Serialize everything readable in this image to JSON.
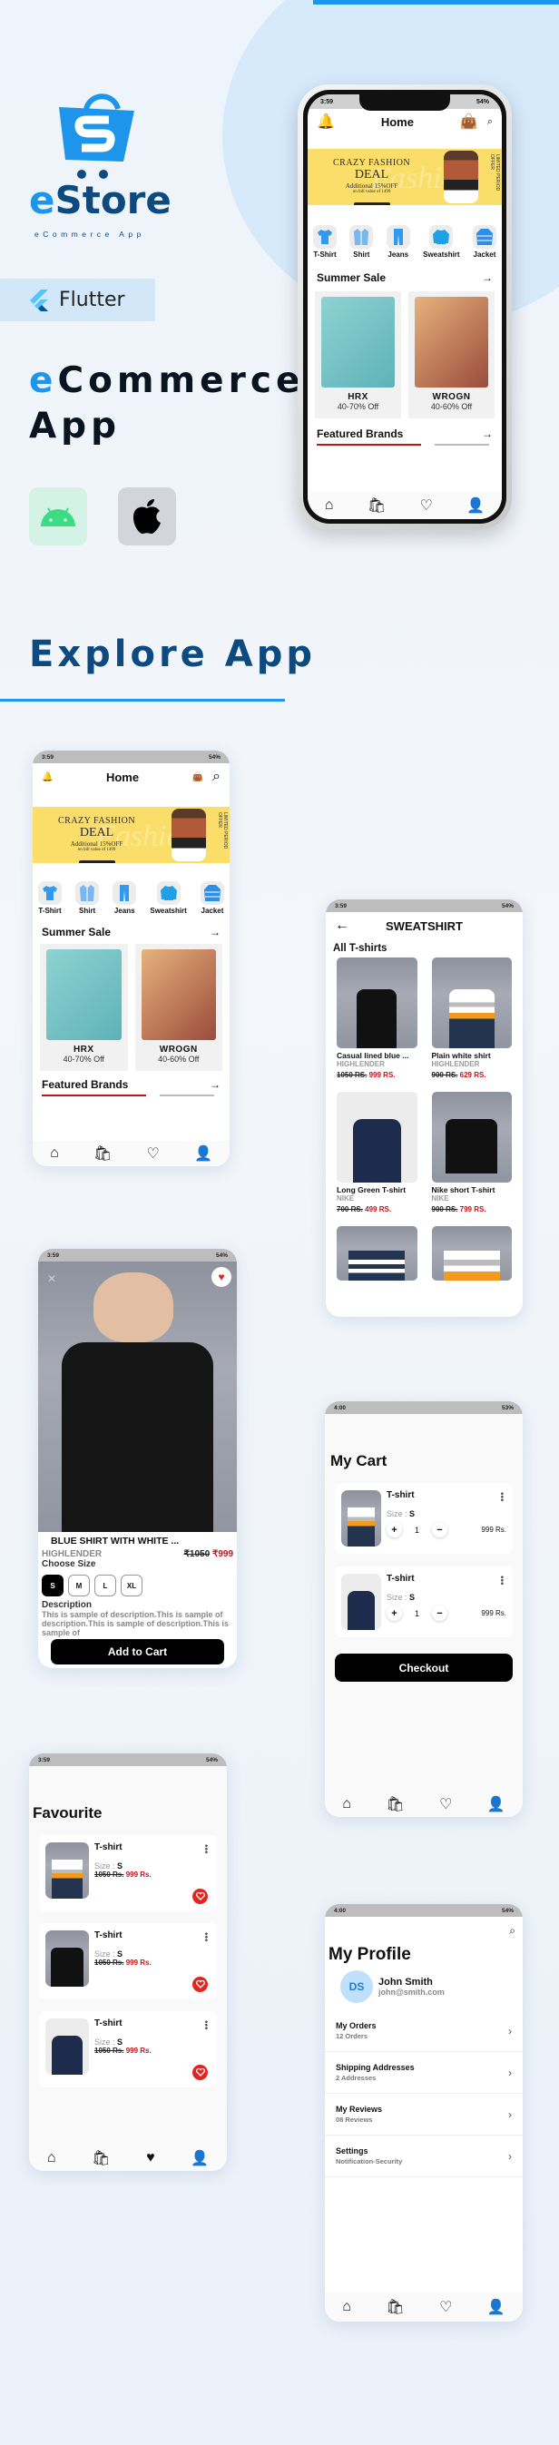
{
  "hero": {
    "brand_e": "e",
    "brand_rest": "Store",
    "tagline": "eCommerce App",
    "framework_label": "Flutter",
    "headline_e": "e",
    "headline_rest": "Commerce",
    "headline_line2": "App",
    "platforms": [
      "android-icon",
      "apple-icon"
    ],
    "explore_title": "Explore App"
  },
  "colors": {
    "accent": "#1C95EA",
    "brand_dark": "#0C4A80",
    "sale_red": "#C0141A",
    "heart_red": "#E0261F"
  },
  "home": {
    "status_left": "3:59",
    "status_right": "54%",
    "title": "Home",
    "banner": {
      "line1": "CRAZY FASHION",
      "line2": "DEAL",
      "line3": "Additional 15%OFF",
      "line4": "on bill value of 1499",
      "watermark": "Fashion",
      "side_text": "LIMITED PERIOD OFFER"
    },
    "categories": [
      {
        "label": "T-Shirt",
        "icon": "tshirt-icon"
      },
      {
        "label": "Shirt",
        "icon": "shirt-icon"
      },
      {
        "label": "Jeans",
        "icon": "jeans-icon"
      },
      {
        "label": "Sweatshirt",
        "icon": "sweatshirt-icon"
      },
      {
        "label": "Jacket",
        "icon": "jacket-icon"
      }
    ],
    "summer_sale_title": "Summer Sale",
    "sale_cards": [
      {
        "brand": "HRX",
        "offer": "40-70% Off"
      },
      {
        "brand": "WROGN",
        "offer": "40-60% Off"
      }
    ],
    "featured_title": "Featured Brands",
    "nav": [
      "home-icon",
      "bag-icon",
      "heart-icon",
      "profile-icon"
    ]
  },
  "listing": {
    "status_left": "3:59",
    "status_right": "54%",
    "title": "SWEATSHIRT",
    "section": "All T-shirts",
    "items": [
      {
        "name": "Casual lined blue ...",
        "brand": "HIGHLENDER",
        "old_price": "1050 RS.",
        "price": "999 RS."
      },
      {
        "name": "Plain white shirt",
        "brand": "HIGHLENDER",
        "old_price": "900 RS.",
        "price": "629 RS."
      },
      {
        "name": "Long Green T-shirt",
        "brand": "NIKE",
        "old_price": "700 RS.",
        "price": "499 RS."
      },
      {
        "name": "Nike short T-shirt",
        "brand": "NIKE",
        "old_price": "900 RS.",
        "price": "799 RS."
      }
    ]
  },
  "detail": {
    "status_left": "3:59",
    "status_right": "54%",
    "name": "BLUE SHIRT WITH WHITE ...",
    "brand": "HIGHLENDER",
    "old_price": "₹1050",
    "price": "₹999",
    "choose_size": "Choose Size",
    "sizes": [
      "S",
      "M",
      "L",
      "XL"
    ],
    "selected_size": "S",
    "description_title": "Description",
    "description": "This is sample of description.This is sample of description.This is sample of description.This is sample of",
    "add_to_cart": "Add to Cart"
  },
  "cart": {
    "status_left": "4:00",
    "status_right": "53%",
    "title": "My Cart",
    "items": [
      {
        "name": "T-shirt",
        "size_label": "Size : ",
        "size": "S",
        "qty": "1",
        "price": "999 Rs."
      },
      {
        "name": "T-shirt",
        "size_label": "Size : ",
        "size": "S",
        "qty": "1",
        "price": "999 Rs."
      }
    ],
    "checkout": "Checkout"
  },
  "favourite": {
    "status_left": "3:59",
    "status_right": "54%",
    "title": "Favourite",
    "items": [
      {
        "name": "T-shirt",
        "size_label": "Size : ",
        "size": "S",
        "old_price": "1050 Rs.",
        "price": "999 Rs."
      },
      {
        "name": "T-shirt",
        "size_label": "Size : ",
        "size": "S",
        "old_price": "1050 Rs.",
        "price": "999 Rs."
      },
      {
        "name": "T-shirt",
        "size_label": "Size : ",
        "size": "S",
        "old_price": "1050 Rs.",
        "price": "999 Rs."
      }
    ]
  },
  "profile": {
    "status_left": "4:00",
    "status_right": "54%",
    "title": "My Profile",
    "initials": "DS",
    "name": "John Smith",
    "email": "john@smith.com",
    "rows": [
      {
        "title": "My Orders",
        "sub": "12 Orders"
      },
      {
        "title": "Shipping Addresses",
        "sub": "2 Addresses"
      },
      {
        "title": "My Reviews",
        "sub": "08 Reviews"
      },
      {
        "title": "Settings",
        "sub": "Notification-Security"
      }
    ]
  }
}
